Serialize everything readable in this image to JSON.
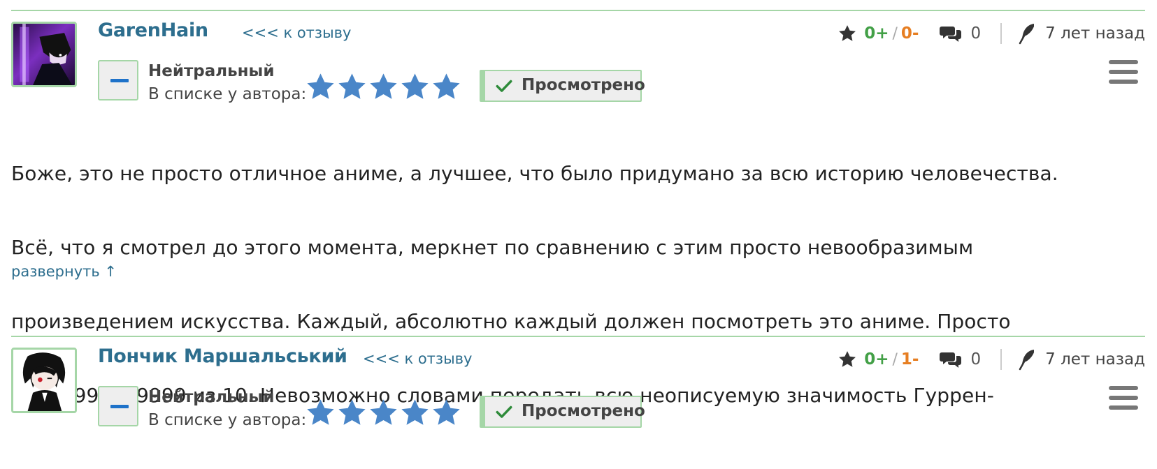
{
  "comments": [
    {
      "username": "GarenHain",
      "back_link": "<<< к отзыву",
      "status": "Нейтральный",
      "in_list_label": "В списке у автора:",
      "rating_stars": 5,
      "watched_label": "Просмотрено",
      "votes_plus": "0+",
      "votes_slash": "/",
      "votes_minus": "0-",
      "comments_count": "0",
      "time_ago": "7 лет назад",
      "text_lines": [
        "Боже, это не просто отличное аниме, а лучшее, что было придумано за всю историю человечества.",
        "Всё, что я смотрел до этого момента, меркнет по сравнению с этим просто невообразимым",
        "произведением искусства. Каждый, абсолютно каждый должен посмотреть это аниме. Просто",
        "99999999999999 из 10. Невозможно словами передать всю неописуемую значимость Гуррен-"
      ],
      "expand_label": "развернуть ↑"
    },
    {
      "username": "Пончик Маршальський",
      "back_link": "<<< к отзыву",
      "status": "Нейтральный",
      "in_list_label": "В списке у автора:",
      "rating_stars": 5,
      "watched_label": "Просмотрено",
      "votes_plus": "0+",
      "votes_slash": "/",
      "votes_minus": "1-",
      "comments_count": "0",
      "time_ago": "7 лет назад"
    }
  ],
  "icons": {
    "rating": "star-icon",
    "comments": "speech-bubbles-icon",
    "time": "feather-quill-icon",
    "menu": "hamburger-menu-icon",
    "watched": "checkmark-icon",
    "vote": "minus-icon"
  },
  "colors": {
    "accent_green": "#a5d6a7",
    "link_blue": "#2d6e8e",
    "star_blue": "#4a86c8",
    "positive": "#43a047",
    "negative": "#e67e22"
  }
}
